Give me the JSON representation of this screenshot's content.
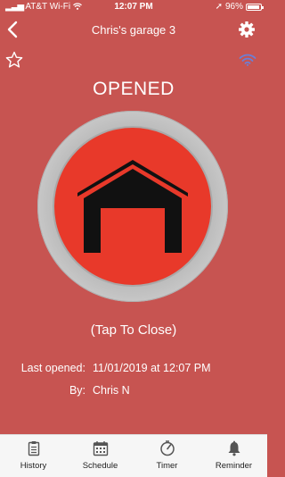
{
  "status_bar": {
    "carrier": "AT&T Wi-Fi",
    "time": "12:07 PM",
    "battery": "96%",
    "battery_level": 0.96
  },
  "header": {
    "title": "Chris's garage 3",
    "back_icon": "chevron-left-icon",
    "settings_icon": "gear-icon",
    "favorite_icon": "star-outline-icon",
    "wifi_icon": "wifi-signal-icon"
  },
  "door": {
    "state": "OPENED",
    "hint": "(Tap To Close)",
    "icon": "garage-open-icon",
    "button_color": "#e8392a",
    "background_color": "#c75451"
  },
  "info": {
    "last_opened_label": "Last opened:",
    "last_opened_value": "11/01/2019 at 12:07 PM",
    "by_label": "By:",
    "by_value": "Chris N"
  },
  "tabs": [
    {
      "label": "History",
      "icon": "clipboard-icon"
    },
    {
      "label": "Schedule",
      "icon": "calendar-icon"
    },
    {
      "label": "Timer",
      "icon": "timer-icon"
    },
    {
      "label": "Reminder",
      "icon": "bell-icon"
    }
  ]
}
